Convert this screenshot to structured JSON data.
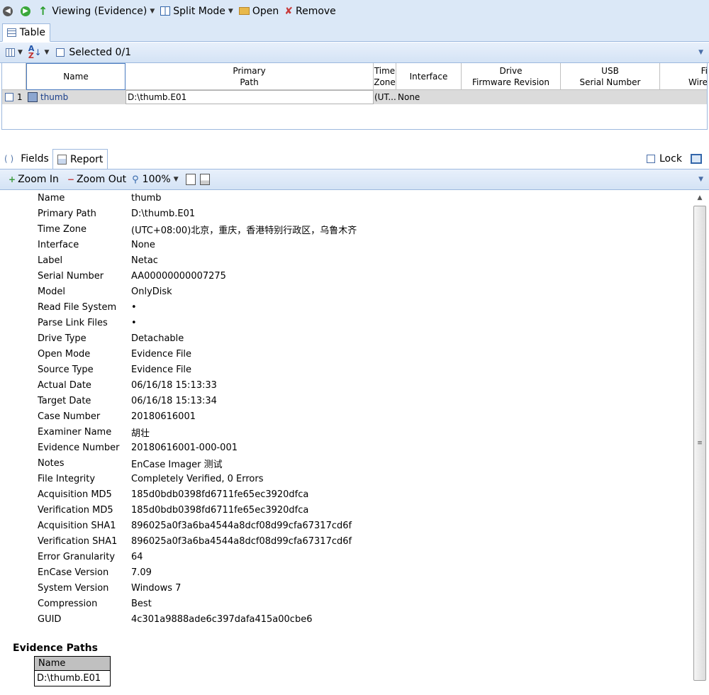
{
  "toolbar": {
    "viewing_label": "Viewing (Evidence)",
    "split_label": "Split Mode",
    "open_label": "Open",
    "remove_label": "Remove"
  },
  "top_tabs": {
    "table_label": "Table"
  },
  "table_toolbar": {
    "selected_label": "Selected 0/1"
  },
  "table": {
    "headers": {
      "name": "Name",
      "primary_path_1": "Primary",
      "primary_path_2": "Path",
      "time_zone_1": "Time",
      "time_zone_2": "Zone",
      "interface": "Interface",
      "drive_fw_1": "Drive",
      "drive_fw_2": "Firmware Revision",
      "usb_1": "USB",
      "usb_2": "Serial Number",
      "fire_1": "Fi",
      "fire_2": "Wire"
    },
    "row": {
      "index": "1",
      "name": "thumb",
      "primary_path": "D:\\thumb.E01",
      "time_zone": "(UT...",
      "interface": "None"
    }
  },
  "view_tabs": {
    "fields_label": "Fields",
    "report_label": "Report",
    "lock_label": "Lock"
  },
  "zoom": {
    "zoom_in_label": "Zoom In",
    "zoom_out_label": "Zoom Out",
    "level": "100%"
  },
  "report": {
    "rows": [
      {
        "k": "Name",
        "v": "thumb"
      },
      {
        "k": "Primary Path",
        "v": "D:\\thumb.E01"
      },
      {
        "k": "Time Zone",
        "v": "(UTC+08:00)北京，重庆，香港特别行政区，乌鲁木齐"
      },
      {
        "k": "Interface",
        "v": "None"
      },
      {
        "k": "Label",
        "v": "Netac"
      },
      {
        "k": "Serial Number",
        "v": "AA00000000007275"
      },
      {
        "k": "Model",
        "v": "OnlyDisk"
      },
      {
        "k": "Read File System",
        "v": "•"
      },
      {
        "k": "Parse Link Files",
        "v": "•"
      },
      {
        "k": "Drive Type",
        "v": "Detachable"
      },
      {
        "k": "Open Mode",
        "v": "Evidence File"
      },
      {
        "k": "Source Type",
        "v": "Evidence File"
      },
      {
        "k": "Actual Date",
        "v": "06/16/18 15:13:33"
      },
      {
        "k": "Target Date",
        "v": "06/16/18 15:13:34"
      },
      {
        "k": "Case Number",
        "v": "20180616001"
      },
      {
        "k": "Examiner Name",
        "v": "胡壮"
      },
      {
        "k": "Evidence Number",
        "v": "20180616001-000-001"
      },
      {
        "k": "Notes",
        "v": "EnCase Imager 测试"
      },
      {
        "k": "File Integrity",
        "v": "Completely Verified, 0 Errors"
      },
      {
        "k": "Acquisition MD5",
        "v": "185d0bdb0398fd6711fe65ec3920dfca"
      },
      {
        "k": "Verification MD5",
        "v": "185d0bdb0398fd6711fe65ec3920dfca"
      },
      {
        "k": "Acquisition SHA1",
        "v": "896025a0f3a6ba4544a8dcf08d99cfa67317cd6f"
      },
      {
        "k": "Verification SHA1",
        "v": "896025a0f3a6ba4544a8dcf08d99cfa67317cd6f"
      },
      {
        "k": "Error Granularity",
        "v": "64"
      },
      {
        "k": "EnCase Version",
        "v": "7.09"
      },
      {
        "k": "System Version",
        "v": "Windows 7"
      },
      {
        "k": "Compression",
        "v": "Best"
      },
      {
        "k": "GUID",
        "v": "4c301a9888ade6c397dafa415a00cbe6"
      }
    ],
    "evidence_paths_title": "Evidence Paths",
    "evidence_paths_header": "Name",
    "evidence_paths_value": "D:\\thumb.E01"
  }
}
